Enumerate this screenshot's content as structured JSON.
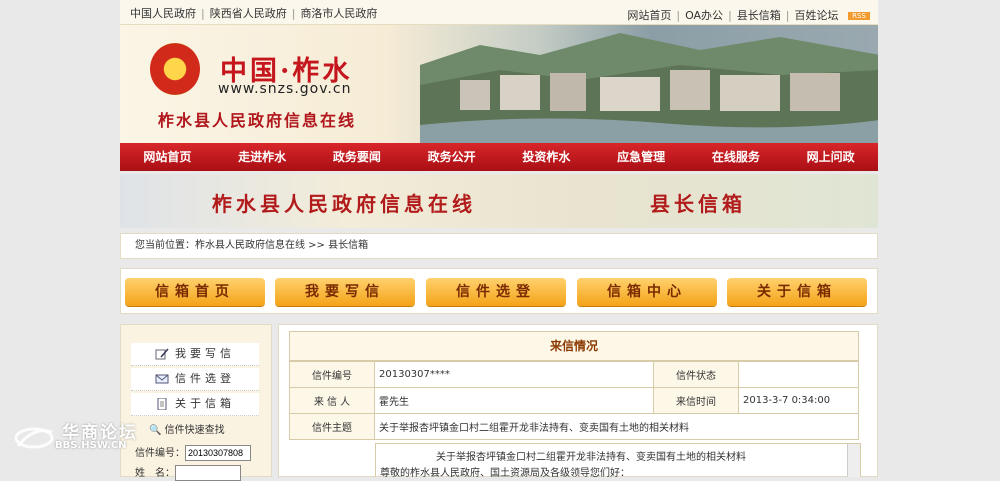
{
  "topbar": {
    "left_links": [
      "中国人民政府",
      "陕西省人民政府",
      "商洛市人民政府"
    ],
    "right_links": [
      "网站首页",
      "OA办公",
      "县长信箱",
      "百姓论坛"
    ],
    "rss_label": "RSS"
  },
  "banner": {
    "title": "中国·柞水",
    "url": "www.snzs.gov.cn",
    "subtitle": "柞水县人民政府信息在线"
  },
  "nav": [
    "网站首页",
    "走进柞水",
    "政务要闻",
    "政务公开",
    "投资柞水",
    "应急管理",
    "在线服务",
    "网上问政"
  ],
  "banner2": {
    "title": "柞水县人民政府信息在线",
    "section": "县长信箱"
  },
  "breadcrumb": {
    "prefix": "您当前位置：",
    "site": "柞水县人民政府信息在线",
    "sep": " >> ",
    "current": "县长信箱"
  },
  "buttons": [
    "信箱首页",
    "我要写信",
    "信件选登",
    "信箱中心",
    "关于信箱"
  ],
  "sidebar": {
    "items": [
      "我要写信",
      "信件选登",
      "关于信箱"
    ],
    "quick_title": "信件快速查找",
    "fields": [
      {
        "label": "信件编号：",
        "value": "20130307808"
      },
      {
        "label": "姓　名：",
        "value": ""
      }
    ]
  },
  "letter": {
    "title": "来信情况",
    "rows": [
      {
        "label1": "信件编号",
        "value1": "20130307****",
        "label2": "信件状态",
        "value2": ""
      },
      {
        "label1": "来 信 人",
        "value1": "霍先生",
        "label2": "来信时间",
        "value2": "2013-3-7 0:34:00"
      }
    ],
    "subject_label": "信件主题",
    "subject": "关于举报杏坪镇金口村二组霍开龙非法持有、变卖国有土地的相关材料",
    "content_line1": "关于举报杏坪镇金口村二组霍开龙非法持有、变卖国有土地的相关材料",
    "content_line2": "尊敬的柞水县人民政府、国土资源局及各级领导您们好："
  },
  "watermark": {
    "name": "华商论坛",
    "url": "BBS.HSW.CN"
  },
  "colors": {
    "nav_red": "#c1181d",
    "button_orange": "#f4a318"
  }
}
